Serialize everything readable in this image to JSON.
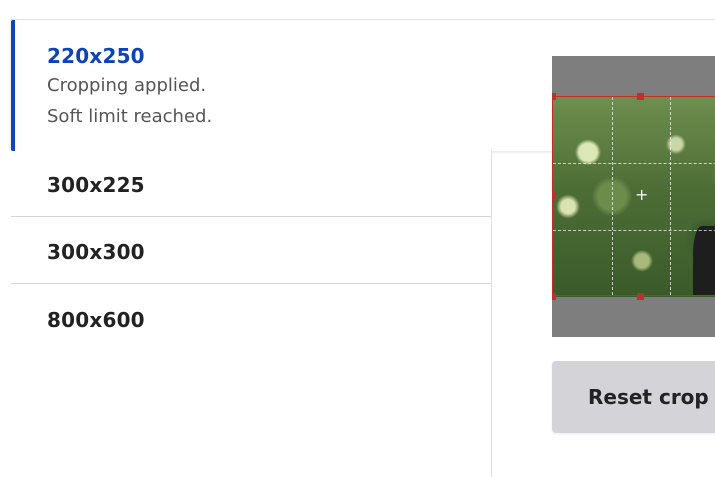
{
  "tabs": [
    {
      "label": "220x250",
      "status": [
        "Cropping applied.",
        "Soft limit reached."
      ],
      "active": true
    },
    {
      "label": "300x225"
    },
    {
      "label": "300x300"
    },
    {
      "label": "800x600"
    }
  ],
  "crop": {
    "center_icon": "+",
    "reset_label": "Reset crop"
  },
  "colors": {
    "accent": "#0b47c0",
    "crop_border": "#c0302a",
    "button_bg": "#d4d4d8"
  }
}
